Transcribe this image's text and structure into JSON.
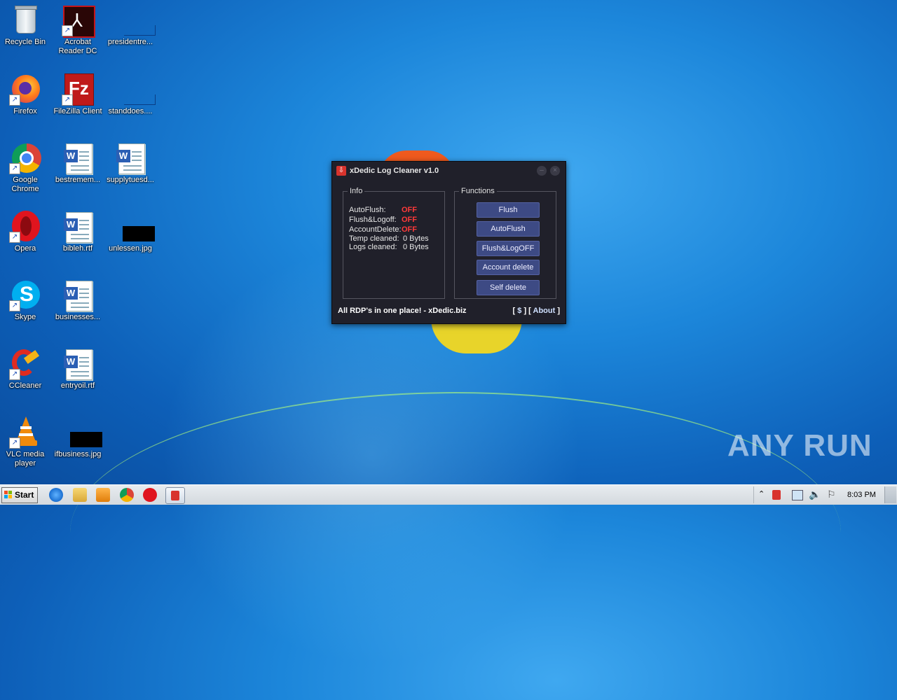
{
  "desktop": {
    "icons": [
      {
        "label": "Recycle Bin"
      },
      {
        "label": "Acrobat Reader DC"
      },
      {
        "label": "presidentre..."
      },
      {
        "label": "Firefox"
      },
      {
        "label": "FileZilla Client"
      },
      {
        "label": "standdoes...."
      },
      {
        "label": "Google Chrome"
      },
      {
        "label": "bestremem..."
      },
      {
        "label": "supplytuesd..."
      },
      {
        "label": "Opera"
      },
      {
        "label": "bibleh.rtf"
      },
      {
        "label": "unlessen.jpg"
      },
      {
        "label": "Skype"
      },
      {
        "label": "businesses..."
      },
      {
        "label": "CCleaner"
      },
      {
        "label": "entryoil.rtf"
      },
      {
        "label": "VLC media player"
      },
      {
        "label": "ifbusiness.jpg"
      }
    ]
  },
  "app": {
    "title": "xDedic Log Cleaner v1.0",
    "info": {
      "legend": "Info",
      "rows": [
        {
          "label": "AutoFlush:",
          "value": "OFF"
        },
        {
          "label": "Flush&Logoff:",
          "value": "OFF"
        },
        {
          "label": "AccountDelete:",
          "value": "OFF"
        },
        {
          "label": "Temp cleaned:",
          "value": "0 Bytes"
        },
        {
          "label": "Logs cleaned:",
          "value": "0 Bytes"
        }
      ]
    },
    "functions": {
      "legend": "Functions",
      "buttons": [
        "Flush",
        "AutoFlush",
        "Flush&LogOFF",
        "Account delete",
        "Self delete"
      ]
    },
    "footer": {
      "tagline": "All RDP's in one place! - xDedic.biz",
      "dollar": "$",
      "about": "About"
    }
  },
  "taskbar": {
    "start_label": "Start",
    "clock": "8:03 PM"
  },
  "watermark": "ANY RUN"
}
